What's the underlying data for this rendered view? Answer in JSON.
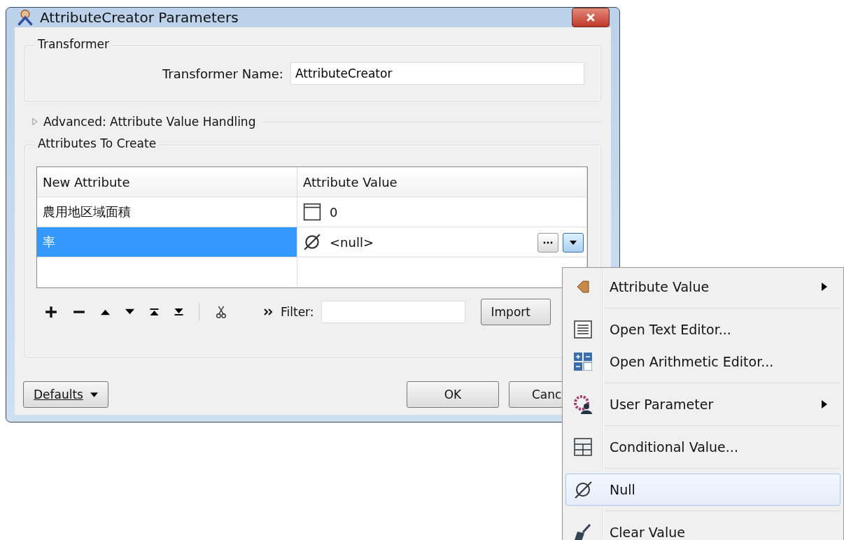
{
  "window": {
    "title": "AttributeCreator Parameters"
  },
  "transformer": {
    "group_title": "Transformer",
    "name_label": "Transformer Name:",
    "name_value": "AttributeCreator"
  },
  "advanced": {
    "label": "Advanced: Attribute Value Handling",
    "expanded": false
  },
  "attributes": {
    "group_title": "Attributes To Create",
    "table": {
      "columns": [
        "New Attribute",
        "Attribute Value"
      ],
      "rows": [
        {
          "name": "農用地区域面積",
          "value": "0",
          "kind": "constant",
          "selected": false
        },
        {
          "name": "率",
          "value": "<null>",
          "kind": "null",
          "selected": true
        }
      ]
    },
    "filter_label": "Filter:",
    "import_button": "Import"
  },
  "buttons": {
    "defaults": "Defaults",
    "ok": "OK",
    "cancel": "Canc"
  },
  "menu": {
    "groups": [
      [
        {
          "label": "Attribute Value",
          "kind": "attribute",
          "submenu": true,
          "selected": false
        }
      ],
      [
        {
          "label": "Open Text Editor...",
          "kind": "text",
          "submenu": false,
          "selected": false
        },
        {
          "label": "Open Arithmetic Editor...",
          "kind": "arithmetic",
          "submenu": false,
          "selected": false
        }
      ],
      [
        {
          "label": "User Parameter",
          "kind": "parameter",
          "submenu": true,
          "selected": false
        }
      ],
      [
        {
          "label": "Conditional Value...",
          "kind": "conditional",
          "submenu": false,
          "selected": false
        }
      ],
      [
        {
          "label": "Null",
          "kind": "null",
          "submenu": false,
          "selected": true
        }
      ],
      [
        {
          "label": "Clear Value",
          "kind": "clear",
          "submenu": false,
          "selected": false
        }
      ]
    ]
  }
}
